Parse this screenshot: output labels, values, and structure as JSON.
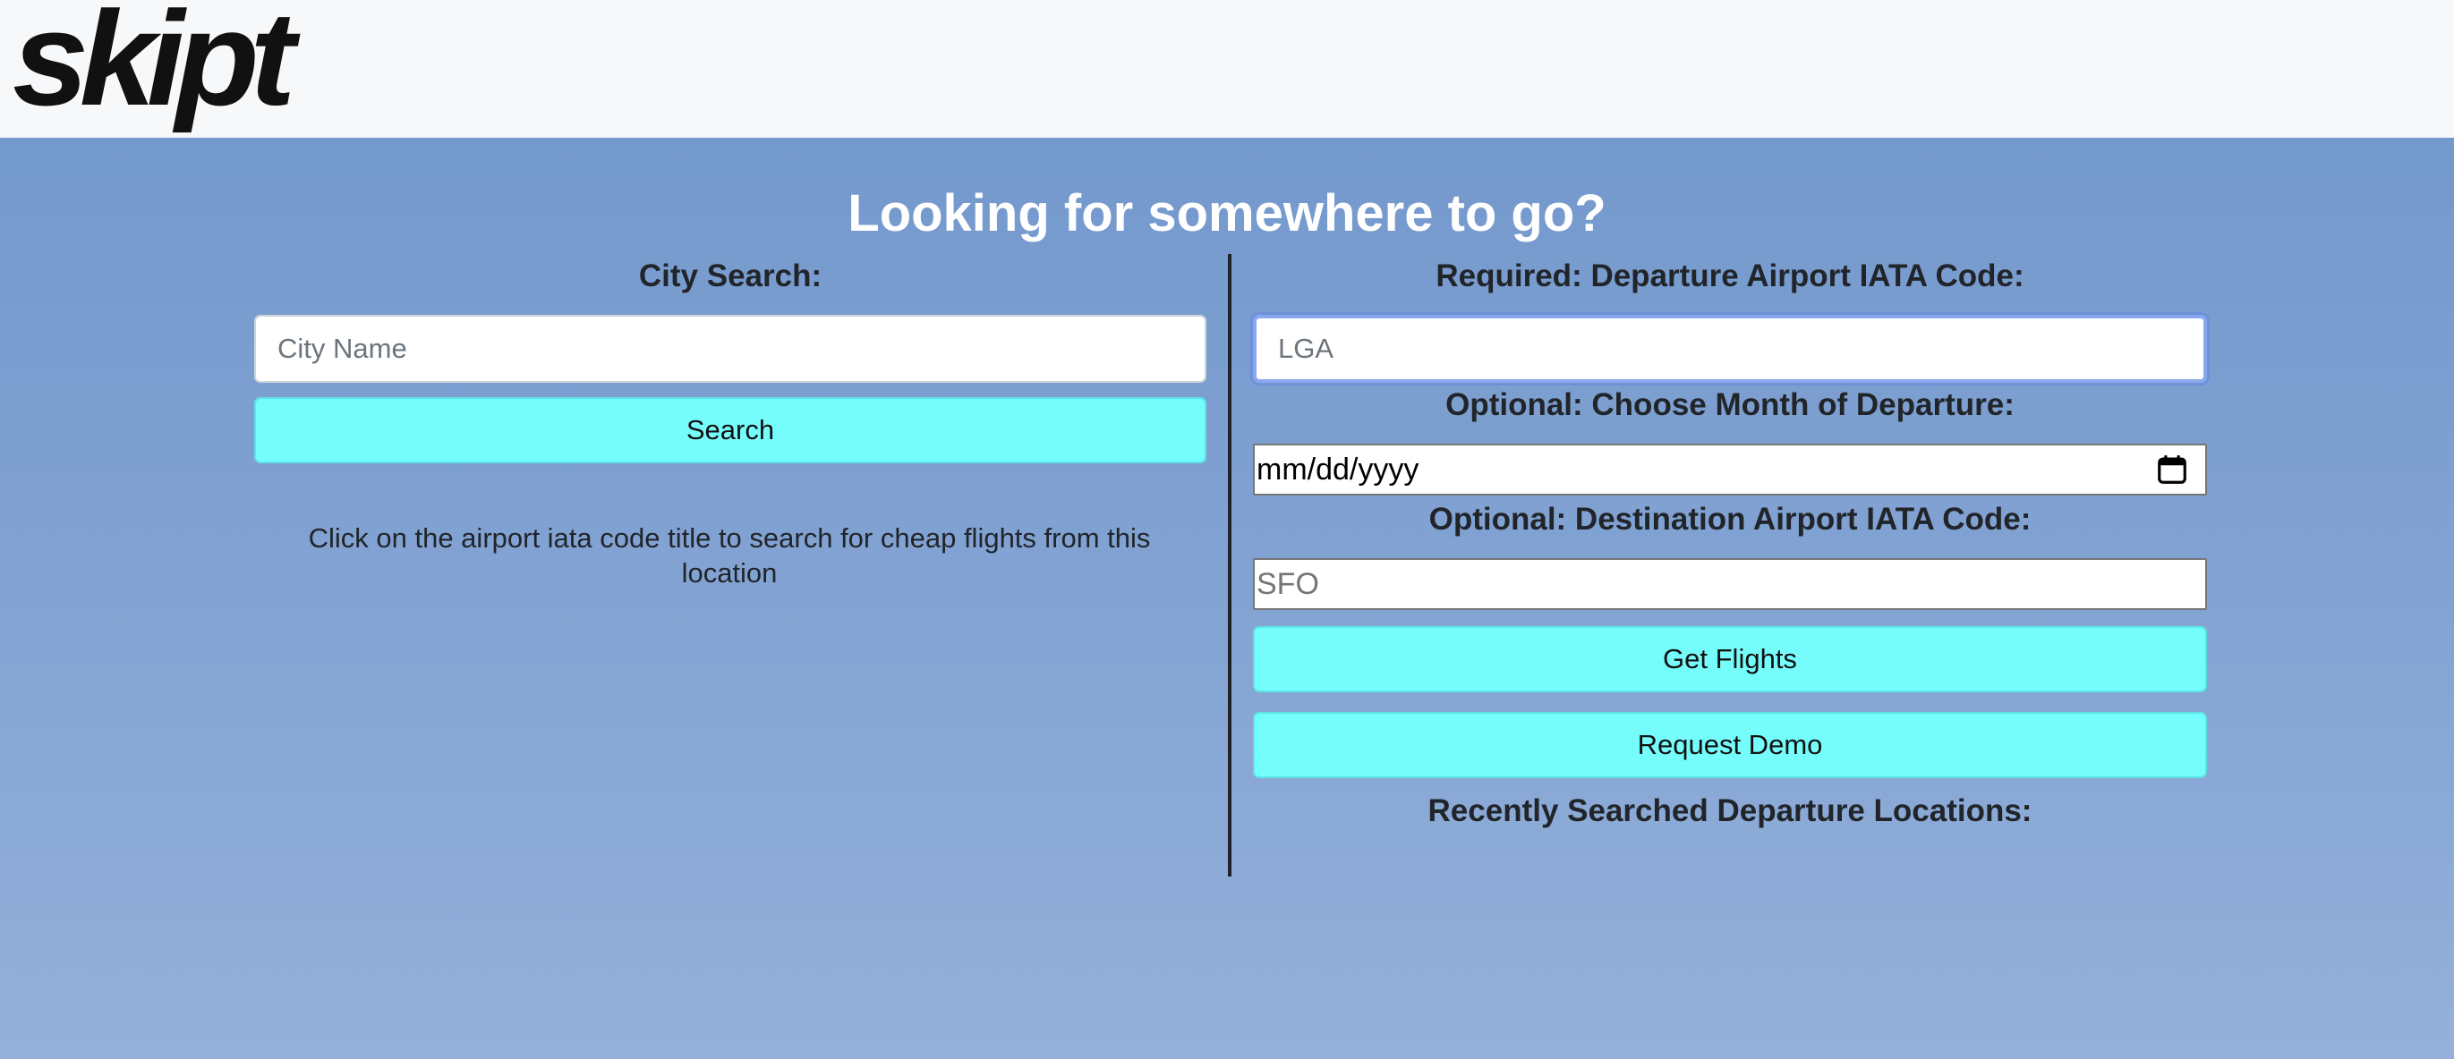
{
  "brand": {
    "logo_text": "skipt"
  },
  "hero": {
    "headline": "Looking for somewhere to go?"
  },
  "city_search": {
    "label": "City Search:",
    "input_placeholder": "City Name",
    "search_button": "Search",
    "hint": "Click on the airport iata code title to search for cheap flights from this location"
  },
  "flight_search": {
    "departure_label": "Required: Departure Airport IATA Code:",
    "departure_placeholder": "LGA",
    "month_label": "Optional: Choose Month of Departure:",
    "date_placeholder": "mm/dd/yyyy",
    "destination_label": "Optional: Destination Airport IATA Code:",
    "destination_placeholder": "SFO",
    "get_flights_button": "Get Flights",
    "request_demo_button": "Request Demo",
    "recent_label": "Recently Searched Departure Locations:"
  },
  "icons": {
    "date_picker": "calendar-icon"
  },
  "colors": {
    "button_bg": "#75fdfc",
    "hero_top": "#7499cd",
    "hero_bottom": "#95b1da",
    "topbar_bg": "#f7f8fa"
  }
}
